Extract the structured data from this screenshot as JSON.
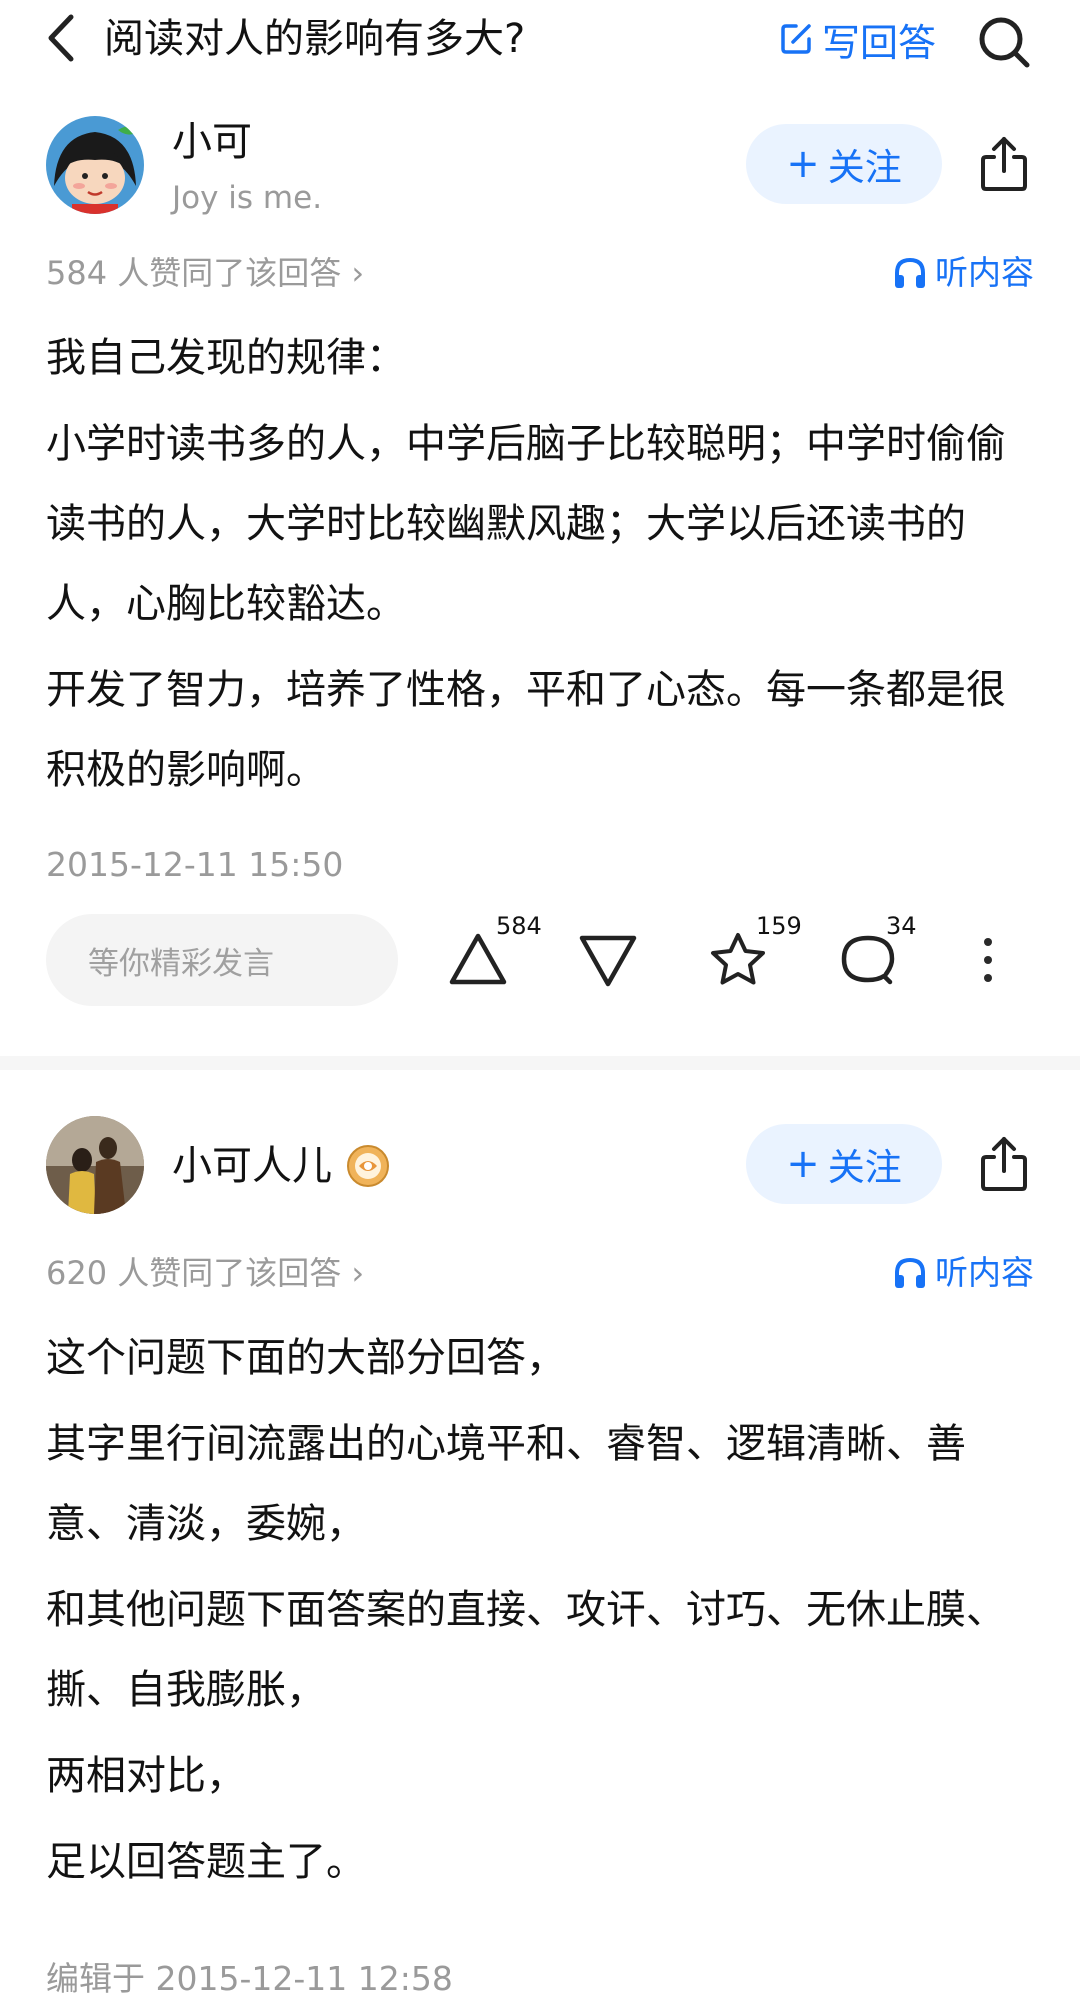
{
  "header": {
    "title": "阅读对人的影响有多大?",
    "write_label": "写回答"
  },
  "answers": [
    {
      "author": "小可",
      "bio": "Joy is me.",
      "follow_label": "关注",
      "votes": "584 人赞同了该回答 ›",
      "listen_label": "听内容",
      "paragraphs": [
        "我自己发现的规律：",
        "小学时读书多的人，中学后脑子比较聪明；中学时偷偷读书的人，大学时比较幽默风趣；大学以后还读书的人，心胸比较豁达。",
        "开发了智力，培养了性格，平和了心态。每一条都是很积极的影响啊。"
      ],
      "timestamp": "2015-12-11 15:50",
      "comment_placeholder": "等你精彩发言",
      "actions": {
        "upvote_count": "584",
        "favorite_count": "159",
        "comment_count": "34"
      }
    },
    {
      "author": "小可人儿",
      "follow_label": "关注",
      "votes": "620 人赞同了该回答 ›",
      "listen_label": "听内容",
      "paragraphs": [
        "这个问题下面的大部分回答，",
        "其字里行间流露出的心境平和、睿智、逻辑清晰、善意、清淡，委婉，",
        "和其他问题下面答案的直接、攻讦、讨巧、无休止膜、撕、自我膨胀，",
        "两相对比，",
        "足以回答题主了。"
      ],
      "timestamp": "编辑于 2015-12-11 12:58"
    }
  ],
  "colors": {
    "accent": "#1772f6",
    "follow_bg": "#eaf3ff",
    "muted_text": "#9a9a9a",
    "body_text": "#121212"
  },
  "icons": [
    "back-arrow-icon",
    "edit-icon",
    "search-icon",
    "share-icon",
    "headphones-icon",
    "upvote-icon",
    "downvote-icon",
    "star-icon",
    "comment-icon",
    "more-icon",
    "creator-badge-icon"
  ]
}
